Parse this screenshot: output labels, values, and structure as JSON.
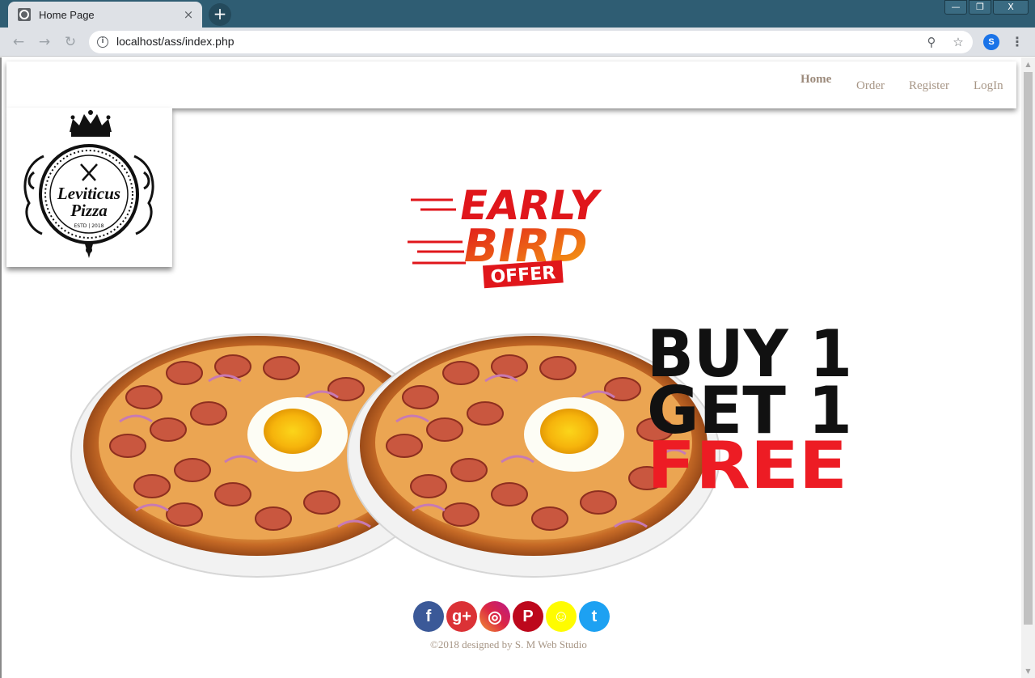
{
  "browser": {
    "tab_title": "Home Page",
    "tab_close_glyph": "×",
    "new_tab_glyph": "+",
    "url": "localhost/ass/index.php",
    "profile_initial": "S",
    "window_buttons": [
      "—",
      "❐",
      "X"
    ]
  },
  "nav": {
    "home": "Home",
    "order": "Order",
    "register": "Register",
    "login": "LogIn"
  },
  "logo": {
    "name_line1": "Leviticus",
    "name_line2": "Pizza",
    "estd": "ESTD | 2018"
  },
  "offer": {
    "line1": "EARLY",
    "line2": "BIRD",
    "badge": "OFFER"
  },
  "promo": {
    "line1": "BUY 1",
    "line2": "GET 1",
    "line3": "FREE"
  },
  "social": [
    {
      "name": "facebook",
      "glyph": "f",
      "color": "#3b5998"
    },
    {
      "name": "google-plus",
      "glyph": "g+",
      "color": "#db3236"
    },
    {
      "name": "instagram",
      "glyph": "◎",
      "color": "#c13584"
    },
    {
      "name": "pinterest",
      "glyph": "P",
      "color": "#bd081c"
    },
    {
      "name": "snapchat",
      "glyph": "☺",
      "color": "#fffc00"
    },
    {
      "name": "twitter",
      "glyph": "t",
      "color": "#1da1f2"
    }
  ],
  "footer": {
    "text": "©2018 designed by S. M Web Studio"
  }
}
